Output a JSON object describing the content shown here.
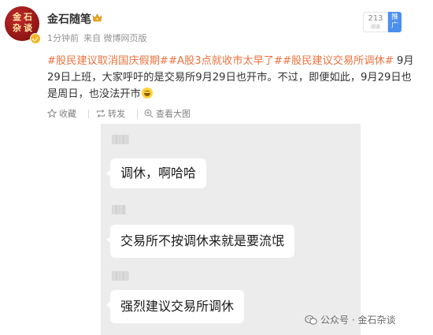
{
  "post": {
    "avatar_chars": [
      "金",
      "石",
      "杂",
      "谈"
    ],
    "author": "金石随笔",
    "time": "1分钟前",
    "source": "来自 微博网页版",
    "views_count": "213",
    "views_label": "阅读",
    "promote_label": "推广",
    "tags": [
      "#股民建议取消国庆假期#",
      "#A股3点就收市太早了#",
      "#股民建议交易所调休#"
    ],
    "text": " 9月29日上班，大家呼吁的是交易所9月29日也开市。不过，即便如此，9月29日也是周日，也没法开市",
    "emoji_name": "laugh-cry-emoji",
    "actions": {
      "favorite": "收藏",
      "repost": "转发",
      "view_large": "查看大图"
    }
  },
  "chat": {
    "messages": [
      "调休，啊哈哈",
      "交易所不按调休来就是要流氓",
      "强烈建议交易所调休"
    ]
  },
  "watermark": {
    "icon": "wechat-official-account-icon",
    "text": "公众号 · 金石杂谈"
  },
  "colors": {
    "tag": "#eb7340",
    "promote": "#4b8ff0",
    "chat_bg": "#ececec",
    "v_badge": "#f5b520"
  }
}
